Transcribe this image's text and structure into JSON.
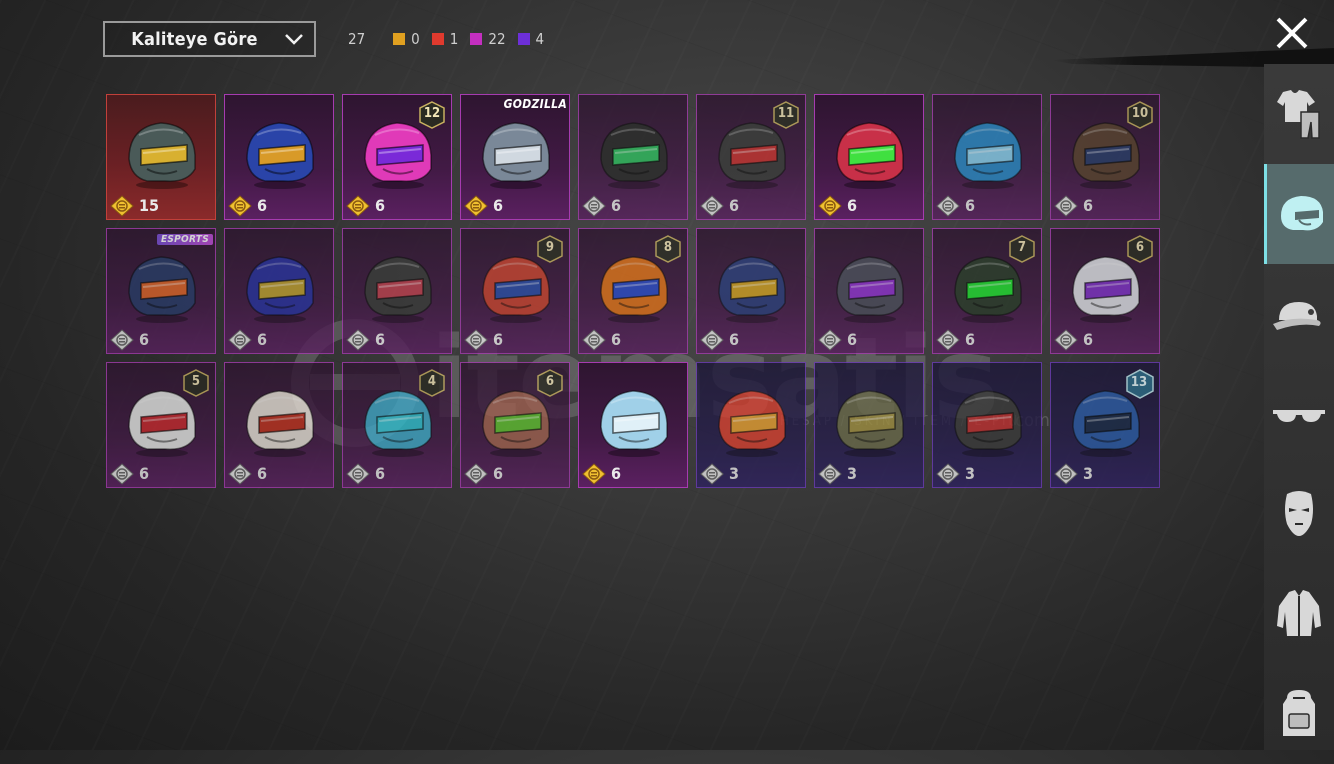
{
  "header": {
    "sort_label": "Kaliteye Göre",
    "total_count": "27",
    "quality_counts": [
      {
        "color": "#e0a020",
        "value": "0"
      },
      {
        "color": "#e03a2e",
        "value": "1"
      },
      {
        "color": "#c42fc0",
        "value": "22"
      },
      {
        "color": "#6d2fd8",
        "value": "4"
      }
    ]
  },
  "watermark": {
    "text": "itemsatis",
    "sub": "HESAP / SKIN / ITEM / E-PIN",
    "com": ".com"
  },
  "sidebar": {
    "items": [
      {
        "name": "outfit",
        "icon": "outfit-icon"
      },
      {
        "name": "helmet",
        "icon": "helmet-icon",
        "active": true
      },
      {
        "name": "hat",
        "icon": "cap-icon"
      },
      {
        "name": "glasses",
        "icon": "glasses-icon"
      },
      {
        "name": "mask",
        "icon": "mask-icon"
      },
      {
        "name": "jacket",
        "icon": "jacket-icon"
      },
      {
        "name": "backpack",
        "icon": "backpack-icon"
      }
    ]
  },
  "items": [
    {
      "quality": "red",
      "coin": "gold",
      "qty": "15",
      "color": "#4a5a58",
      "accent": "#d8b030"
    },
    {
      "quality": "purple",
      "coin": "gold",
      "qty": "6",
      "color": "#2a44a8",
      "accent": "#d89a28"
    },
    {
      "quality": "purple",
      "coin": "gold",
      "qty": "6",
      "color": "#e03ab8",
      "accent": "#7a2ad8",
      "level": "12"
    },
    {
      "quality": "purple",
      "coin": "gold",
      "qty": "6",
      "color": "#7a8898",
      "accent": "#d0d8e0",
      "tag": "GODZILLA"
    },
    {
      "quality": "purple",
      "coin": "silver",
      "qty": "6",
      "color": "#2a2a2a",
      "accent": "#30c060",
      "dim": true
    },
    {
      "quality": "purple",
      "coin": "silver",
      "qty": "6",
      "color": "#3a3a3a",
      "accent": "#c83030",
      "level": "11",
      "dim": true
    },
    {
      "quality": "purple",
      "coin": "gold",
      "qty": "6",
      "color": "#c83048",
      "accent": "#40e040"
    },
    {
      "quality": "purple",
      "coin": "silver",
      "qty": "6",
      "color": "#2a88c8",
      "accent": "#8ad0f0",
      "dim": true
    },
    {
      "quality": "purple",
      "coin": "silver",
      "qty": "6",
      "color": "#5a4030",
      "accent": "#2a3a6a",
      "level": "10",
      "dim": true
    },
    {
      "quality": "purple",
      "coin": "silver",
      "qty": "6",
      "color": "#2a3a6a",
      "accent": "#e0642a",
      "tag": "ESPORTS",
      "dim": true
    },
    {
      "quality": "purple",
      "coin": "silver",
      "qty": "6",
      "color": "#2a30a0",
      "accent": "#c0a030",
      "dim": true
    },
    {
      "quality": "purple",
      "coin": "silver",
      "qty": "6",
      "color": "#3a3a3a",
      "accent": "#c04050",
      "dim": true
    },
    {
      "quality": "purple",
      "coin": "silver",
      "qty": "6",
      "color": "#c84030",
      "accent": "#2a4aa8",
      "level": "9",
      "dim": true
    },
    {
      "quality": "purple",
      "coin": "silver",
      "qty": "6",
      "color": "#e07018",
      "accent": "#2a48c8",
      "level": "8",
      "dim": true
    },
    {
      "quality": "purple",
      "coin": "silver",
      "qty": "6",
      "color": "#2a3a7a",
      "accent": "#d0a020",
      "dim": true
    },
    {
      "quality": "purple",
      "coin": "silver",
      "qty": "6",
      "color": "#4a4a5a",
      "accent": "#9030d0",
      "dim": true
    },
    {
      "quality": "purple",
      "coin": "silver",
      "qty": "6",
      "color": "#2a3a2a",
      "accent": "#20e030",
      "level": "7",
      "dim": true
    },
    {
      "quality": "purple",
      "coin": "silver",
      "qty": "6",
      "color": "#e0e0e8",
      "accent": "#8030c8",
      "level": "6",
      "dim": true
    },
    {
      "quality": "purple",
      "coin": "silver",
      "qty": "6",
      "color": "#e8e8e8",
      "accent": "#c82830",
      "level": "5",
      "dim": true
    },
    {
      "quality": "purple",
      "coin": "silver",
      "qty": "6",
      "color": "#e8e0d8",
      "accent": "#c03020",
      "dim": true
    },
    {
      "quality": "purple",
      "coin": "silver",
      "qty": "6",
      "color": "#40a8c8",
      "accent": "#30c0d0",
      "level": "4",
      "dim": true
    },
    {
      "quality": "purple",
      "coin": "silver",
      "qty": "6",
      "color": "#a06050",
      "accent": "#60c030",
      "level": "6",
      "dim": true
    },
    {
      "quality": "purple",
      "coin": "gold",
      "qty": "6",
      "color": "#a0d0e8",
      "accent": "#e0f0f8"
    },
    {
      "quality": "violet",
      "coin": "silver",
      "qty": "3",
      "color": "#d84030",
      "accent": "#e8a030",
      "dim": true
    },
    {
      "quality": "violet",
      "coin": "silver",
      "qty": "3",
      "color": "#6a6a4a",
      "accent": "#a09040",
      "dim": true
    },
    {
      "quality": "violet",
      "coin": "silver",
      "qty": "3",
      "color": "#3a3a3a",
      "accent": "#c03030",
      "dim": true
    },
    {
      "quality": "violet",
      "coin": "silver",
      "qty": "3",
      "color": "#2a5aa8",
      "accent": "#1a2a4a",
      "badge": "13",
      "dim": true
    }
  ]
}
